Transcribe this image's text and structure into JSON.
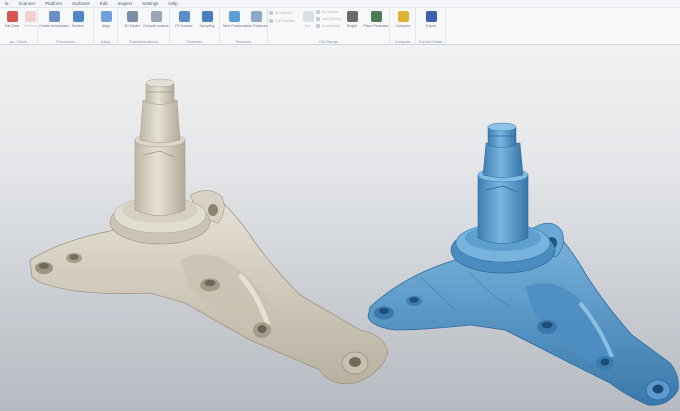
{
  "menu": [
    "le",
    "Scanner",
    "Platform",
    "Surfaces",
    "Edit",
    "Inspect",
    "Settings",
    "Help"
  ],
  "ribbon": {
    "groups": [
      {
        "label": "an / Save",
        "buttons": [
          {
            "label": "Set Data",
            "icon": "scan-icon",
            "color": "#d9534f",
            "dim": false
          },
          {
            "label": "Preview",
            "icon": "preview-icon",
            "color": "#e8a09a",
            "dim": true
          }
        ]
      },
      {
        "label": "Processes",
        "buttons": [
          {
            "label": "Delete Unselected",
            "icon": "delete-icon",
            "color": "#6b8fbf",
            "dim": false
          },
          {
            "label": "Surface",
            "icon": "surface-icon",
            "color": "#4f86c6",
            "dim": false
          }
        ]
      },
      {
        "label": "Align",
        "buttons": [
          {
            "label": "Align",
            "icon": "align-icon",
            "color": "#6fa0d8",
            "dim": false
          }
        ]
      },
      {
        "label": "Transformations",
        "buttons": [
          {
            "label": "3D Model",
            "icon": "model-icon",
            "color": "#7b8ea8",
            "dim": false
          },
          {
            "label": "Exclude surface",
            "icon": "exclude-icon",
            "color": "#9aa6b5",
            "dim": false
          }
        ]
      },
      {
        "label": "Features",
        "buttons": [
          {
            "label": "Fit Surface",
            "icon": "fit-icon",
            "color": "#5b8cc9",
            "dim": false
          },
          {
            "label": "Sampling",
            "icon": "sampling-icon",
            "color": "#4a7dbd",
            "dim": false
          }
        ]
      },
      {
        "label": "Features",
        "buttons": [
          {
            "label": "New Features",
            "icon": "feature-icon",
            "color": "#5aa0d6",
            "dim": false
          },
          {
            "label": "Auto Features",
            "icon": "auto-feature-icon",
            "color": "#8fa8c6",
            "dim": false
          }
        ]
      },
      {
        "label": "Cut Range",
        "buttons": [
          {
            "label": "Bev",
            "icon": "bev-icon",
            "color": "#b8c0ca",
            "dim": true
          },
          {
            "label": "Reglet",
            "icon": "reglet-icon",
            "color": "#6b6b6b",
            "dim": false
          },
          {
            "label": "Place Proactive",
            "icon": "proactive-icon",
            "color": "#4d7a55",
            "dim": false
          }
        ]
      },
      {
        "label": "Analysis",
        "buttons": [
          {
            "label": "Compare",
            "icon": "compare-icon",
            "color": "#e0b030",
            "dim": false
          }
        ]
      },
      {
        "label": "Export Model",
        "buttons": [
          {
            "label": "Export",
            "icon": "export-icon",
            "color": "#3f5fae",
            "dim": false
          }
        ]
      }
    ],
    "mini_left": [
      "Bloc Model",
      "Grid Transfer"
    ],
    "mini_right": [
      "By Surface",
      "Auto (Select)",
      "Accessibility"
    ]
  },
  "viewport": {
    "left_part_color": "#d7d1c3",
    "right_part_color": "#5a9ac9"
  }
}
